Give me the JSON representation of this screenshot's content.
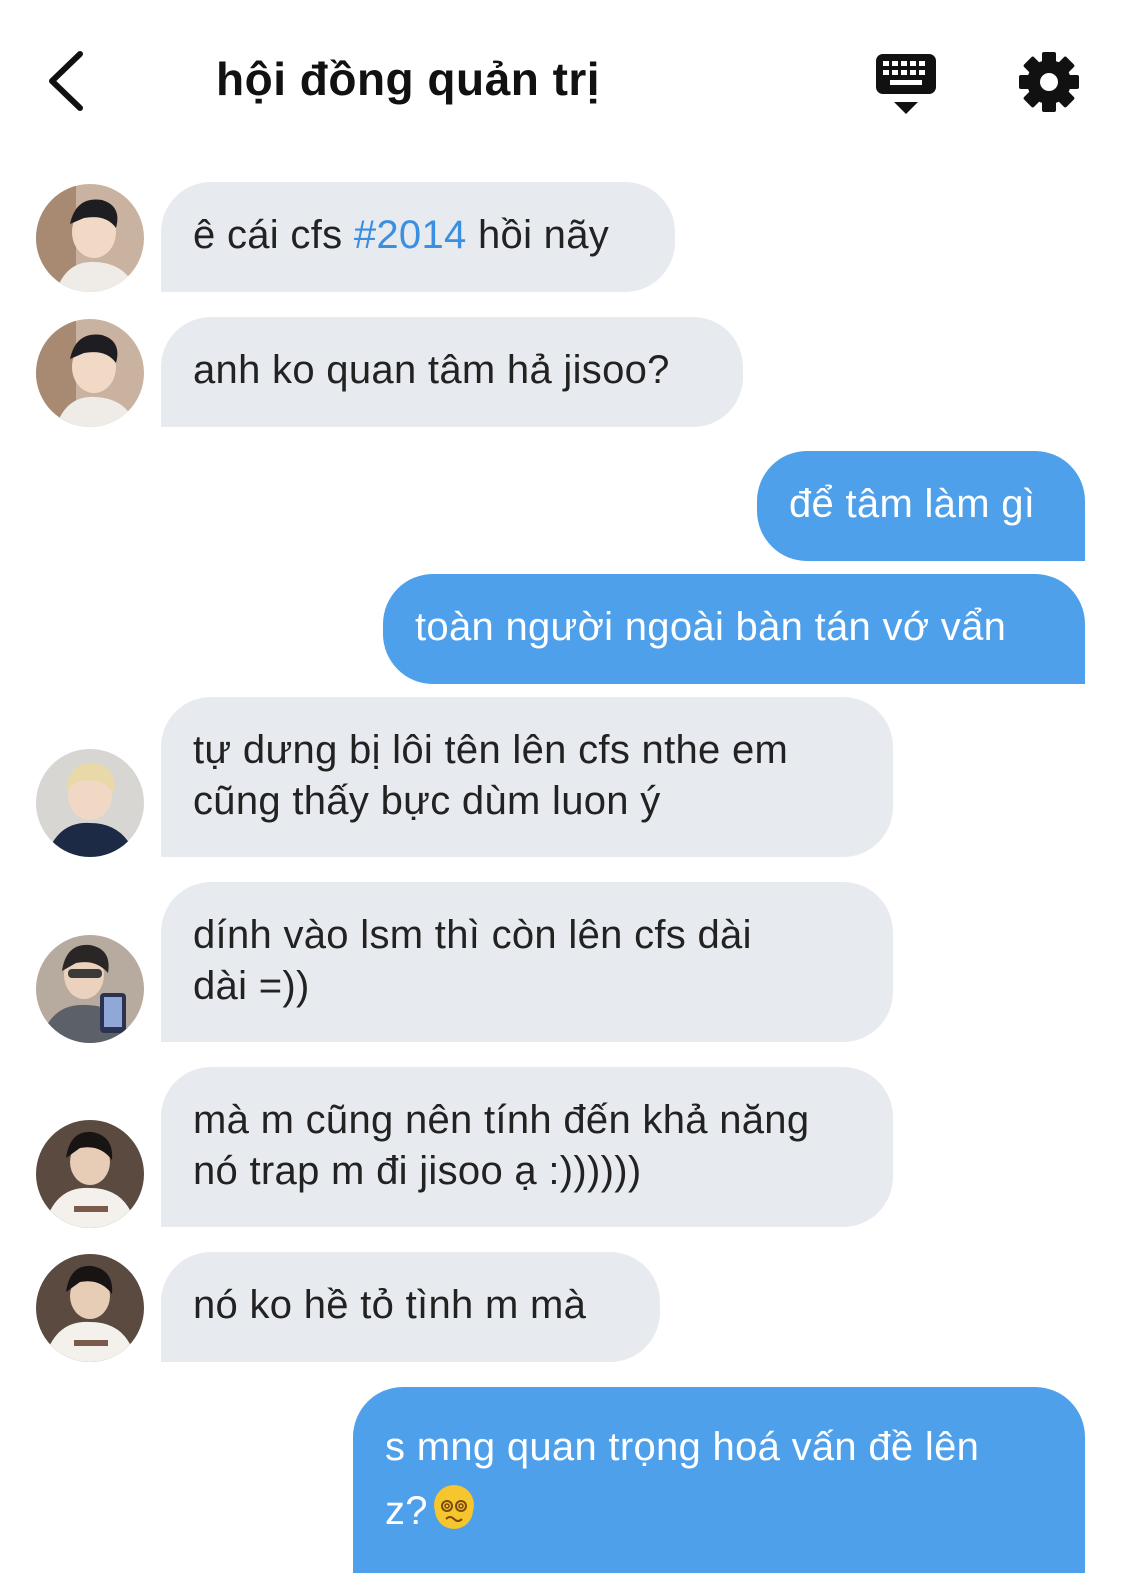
{
  "header": {
    "title": "hội đồng quản trị",
    "icons": {
      "back": "chevron-left-icon",
      "keyboard": "keyboard-icon",
      "settings": "gear-icon"
    }
  },
  "colors": {
    "incoming_bubble": "#e7eaef",
    "outgoing_bubble": "#4fa0ea",
    "hashtag": "#3a8fe0"
  },
  "messages": [
    {
      "direction": "in",
      "avatar": "avatar-member-1",
      "parts": [
        "ê cái cfs ",
        "#2014",
        " hồi nãy"
      ]
    },
    {
      "direction": "in",
      "avatar": "avatar-member-1",
      "text": "anh ko quan tâm hả jisoo?"
    },
    {
      "direction": "out",
      "text": "để tâm làm gì"
    },
    {
      "direction": "out",
      "text": "toàn người ngoài bàn tán vớ vẩn"
    },
    {
      "direction": "in",
      "avatar": "avatar-member-2",
      "lines": [
        "tự dưng bị lôi tên lên cfs nthe em",
        "cũng thấy bực dùm luon ý"
      ]
    },
    {
      "direction": "in",
      "avatar": "avatar-member-3",
      "lines": [
        "dính vào lsm thì còn lên cfs dài",
        "dài =))"
      ]
    },
    {
      "direction": "in",
      "avatar": "avatar-member-4",
      "lines": [
        "mà m cũng nên tính đến khả năng",
        "nó trap m đi jisoo ạ :))))))"
      ]
    },
    {
      "direction": "in",
      "avatar": "avatar-member-4",
      "text": "nó ko hề tỏ tình m mà"
    },
    {
      "direction": "out",
      "lines": [
        "s mng quan trọng hoá vấn đề lên",
        "z?"
      ],
      "emoji": "dizzy-face-emoji"
    }
  ]
}
